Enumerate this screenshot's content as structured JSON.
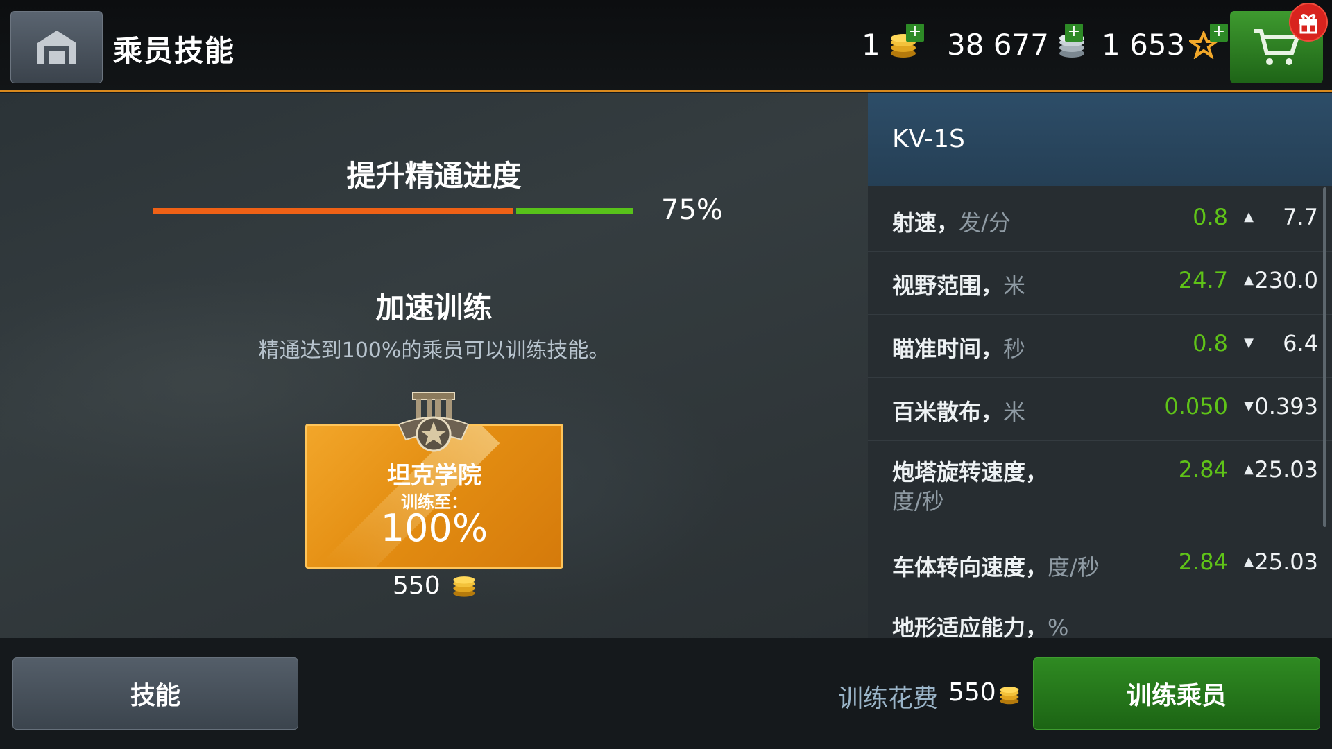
{
  "header": {
    "title": "乘员技能",
    "currencies": {
      "gold": "1",
      "silver": "38 677",
      "free_xp": "1 653"
    },
    "plus_label": "+"
  },
  "mastery": {
    "title": "提升精通进度",
    "progress_text": "75%",
    "progress_fraction": 0.75
  },
  "accelerate": {
    "title": "加速训练",
    "description": "精通达到100%的乘员可以训练技能。"
  },
  "academy": {
    "name": "坦克学院",
    "train_label": "训练至：",
    "level": "100%",
    "price": "550"
  },
  "vehicle": {
    "name": "KV-1S"
  },
  "stats": [
    {
      "label": "射速，",
      "unit": "发/分",
      "delta": "0.8",
      "direction": "up",
      "value": "7.7"
    },
    {
      "label": "视野范围，",
      "unit": "米",
      "delta": "24.7",
      "direction": "up",
      "value": "230.0"
    },
    {
      "label": "瞄准时间，",
      "unit": "秒",
      "delta": "0.8",
      "direction": "down",
      "value": "6.4"
    },
    {
      "label": "百米散布，",
      "unit": "米",
      "delta": "0.050",
      "direction": "down",
      "value": "0.393"
    },
    {
      "label": "炮塔旋转速度，",
      "unit": "度/秒",
      "delta": "2.84",
      "direction": "up",
      "value": "25.03"
    },
    {
      "label": "车体转向速度，",
      "unit": "度/秒",
      "delta": "2.84",
      "direction": "up",
      "value": "25.03"
    },
    {
      "label": "地形适应能力，",
      "unit": "%",
      "delta": "",
      "direction": "",
      "value": ""
    }
  ],
  "footer": {
    "skills_button": "技能",
    "train_cost_label": "训练花费",
    "train_cost_value": "550",
    "train_crew_button": "训练乘员"
  },
  "colors": {
    "accent_orange": "#d9891d",
    "progress_orange": "#ef6116",
    "progress_green": "#58c21a",
    "stat_delta_green": "#5fc318",
    "button_green": "#2f8a22"
  }
}
